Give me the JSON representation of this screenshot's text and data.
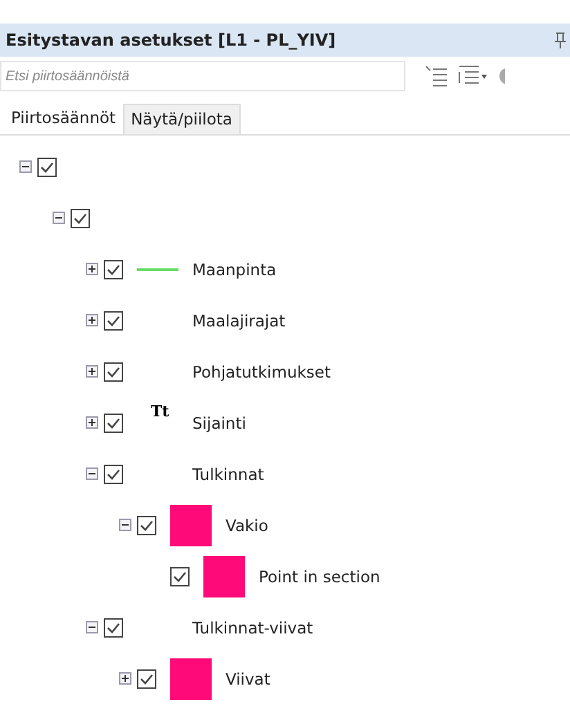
{
  "panel": {
    "title": "Esitystavan asetukset [L1 - PL_YIV]"
  },
  "search": {
    "placeholder": "Etsi piirtosäännöistä"
  },
  "tabs": [
    {
      "label": "Piirtosäännöt",
      "selected": true
    },
    {
      "label": "Näytä/piilota",
      "selected": false
    }
  ],
  "tree": [
    {
      "checked": true,
      "expanded": true,
      "children": [
        {
          "checked": true,
          "expanded": true,
          "children": [
            {
              "label": "Maanpinta",
              "checked": true,
              "expanded": false,
              "symbol": {
                "kind": "line",
                "color": "#66dd66"
              }
            },
            {
              "label": "Maalajirajat",
              "checked": true,
              "expanded": false
            },
            {
              "label": "Pohjatutkimukset",
              "checked": true,
              "expanded": false
            },
            {
              "label": "Sijainti",
              "checked": true,
              "expanded": false,
              "symbol": {
                "kind": "text",
                "text": "Tt"
              }
            },
            {
              "label": "Tulkinnat",
              "checked": true,
              "expanded": true,
              "children": [
                {
                  "label": "Vakio",
                  "checked": true,
                  "expanded": true,
                  "symbol": {
                    "kind": "fill",
                    "color": "#ff0a78"
                  },
                  "children": [
                    {
                      "label": "Point in section",
                      "checked": true,
                      "symbol": {
                        "kind": "fill",
                        "color": "#ff0a78"
                      }
                    }
                  ]
                }
              ]
            },
            {
              "label": "Tulkinnat-viivat",
              "checked": true,
              "expanded": true,
              "children": [
                {
                  "label": "Viivat",
                  "checked": true,
                  "expanded": false,
                  "symbol": {
                    "kind": "fill",
                    "color": "#ff0a78"
                  }
                }
              ]
            }
          ]
        }
      ]
    }
  ]
}
